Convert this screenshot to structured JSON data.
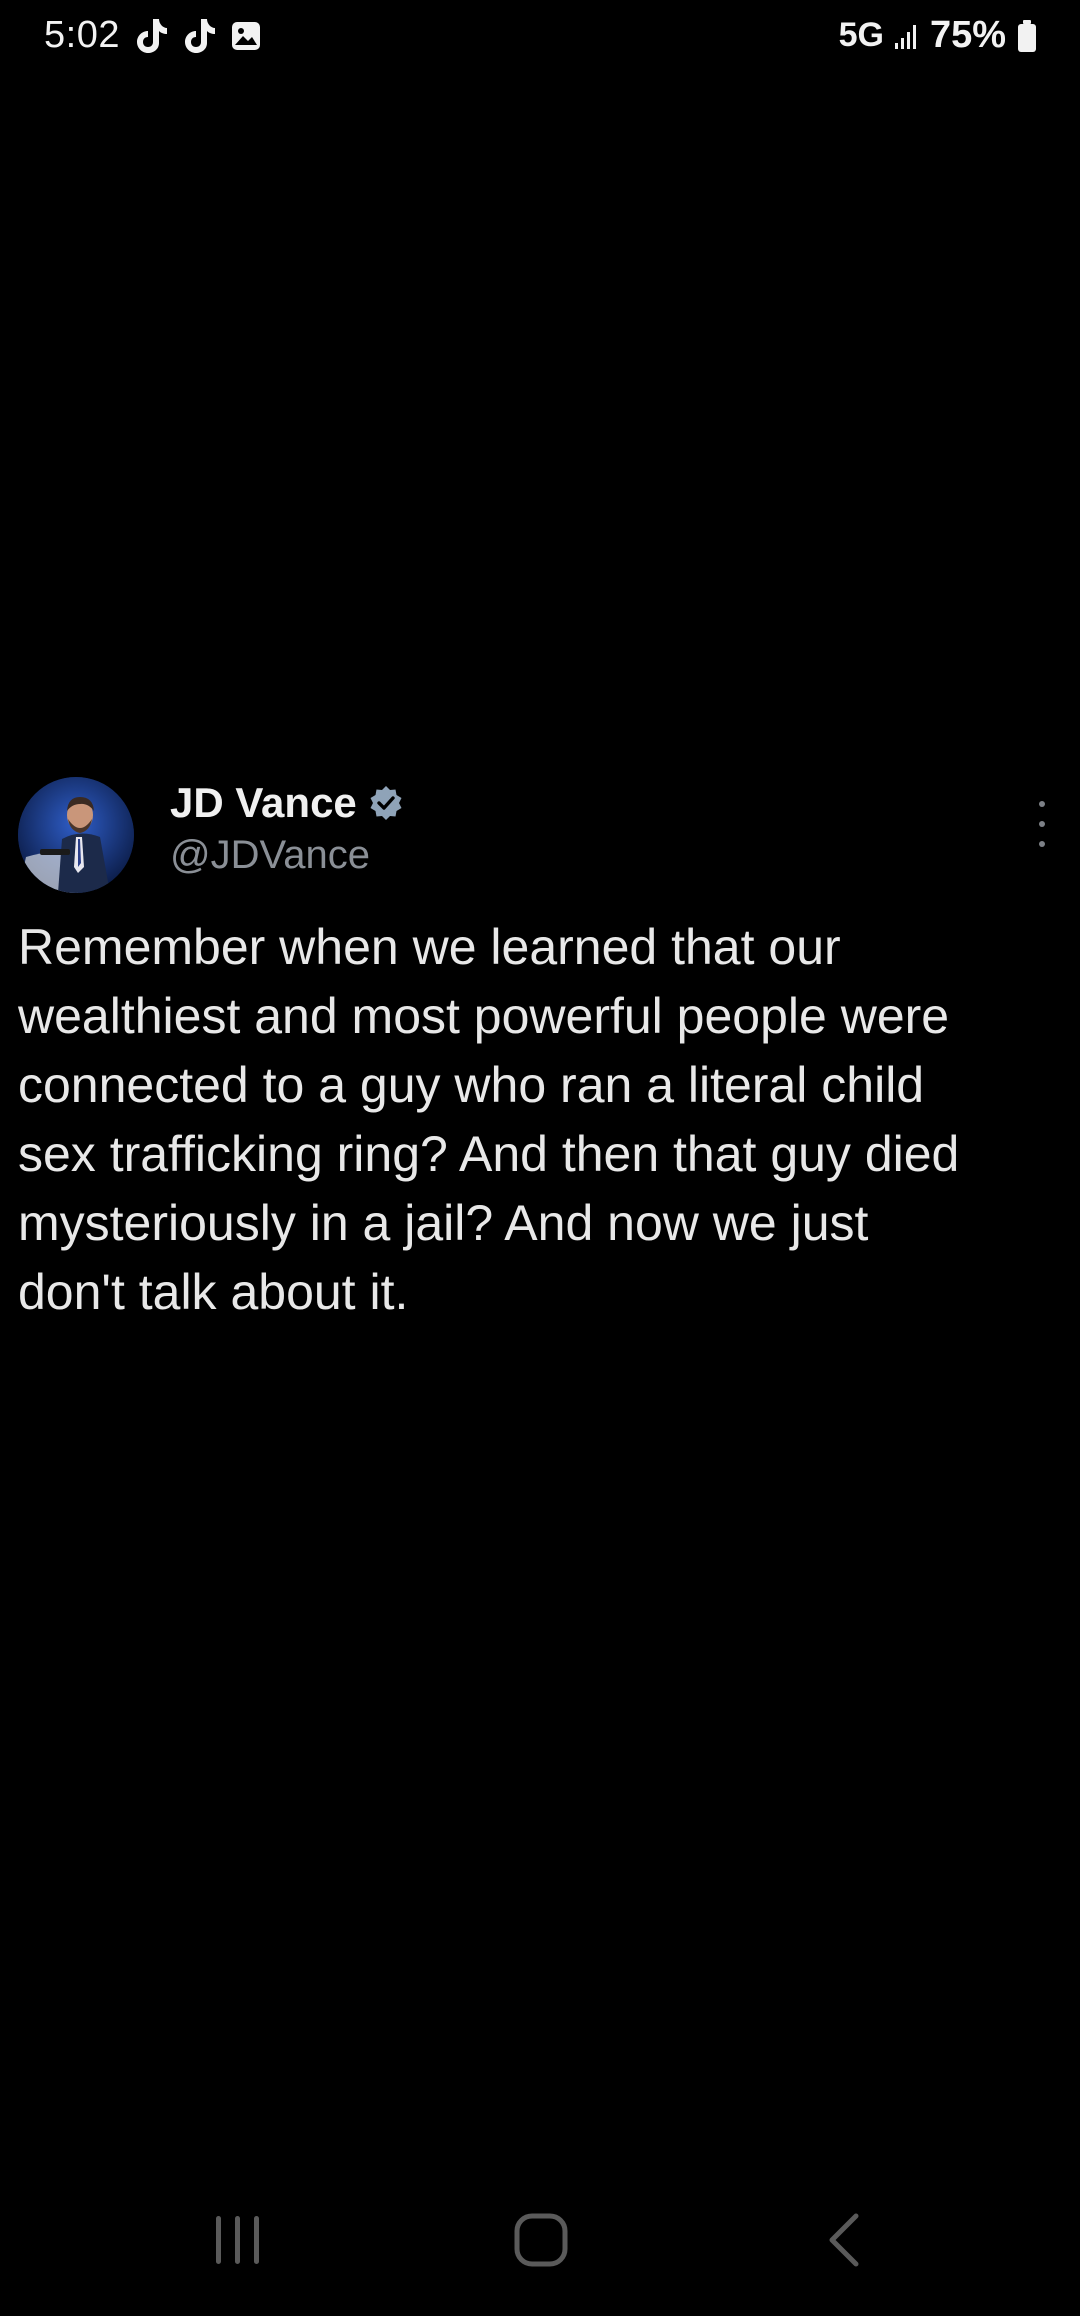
{
  "status_bar": {
    "time": "5:02",
    "notification_icons": [
      "tiktok-icon",
      "tiktok-icon",
      "gallery-icon"
    ],
    "network": "5G",
    "battery_percent": "75%"
  },
  "tweet": {
    "author_name": "JD Vance",
    "verified": true,
    "author_handle": "@JDVance",
    "text_lines": [
      "Remember when we learned that our",
      "wealthiest and most powerful people were",
      "connected to a guy who ran a literal child",
      "sex trafficking ring? And then that guy died",
      "mysteriously in a jail? And now we just",
      "don't talk about it."
    ]
  },
  "nav_bar": {
    "buttons": [
      "recents-icon",
      "home-icon",
      "back-icon"
    ]
  },
  "colors": {
    "background": "#000000",
    "text": "#e8e8e8",
    "handle": "#8a8f96",
    "verified_badge": "#8fa3b8"
  }
}
